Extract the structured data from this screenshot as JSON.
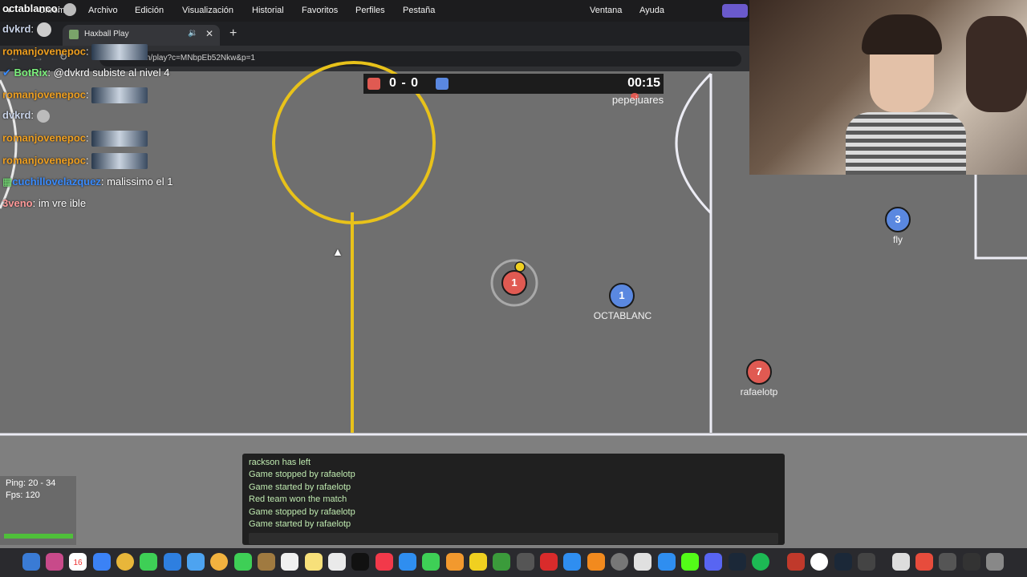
{
  "menubar": {
    "app_name": "Chrome",
    "items": [
      "Archivo",
      "Edición",
      "Visualización",
      "Historial",
      "Favoritos",
      "Perfiles",
      "Pestaña",
      "Ventana",
      "Ayuda"
    ]
  },
  "browser": {
    "tab_title": "Haxball Play",
    "url": "haxball.com/play?c=MNbpEb52Nkw&p=1"
  },
  "scoreboard": {
    "score": "0 - 0",
    "time": "00:15",
    "red_color": "#e05a52",
    "blue_color": "#5a88e0"
  },
  "players": [
    {
      "number": "1",
      "name": "",
      "team": "red"
    },
    {
      "number": "1",
      "name": "OCTABLANC",
      "team": "blue"
    },
    {
      "number": "3",
      "name": "fly",
      "team": "blue"
    },
    {
      "number": "7",
      "name": "rafaelotp",
      "team": "red"
    },
    {
      "number": "",
      "name": "pepejuares",
      "team": "red"
    }
  ],
  "stream_chat": [
    {
      "user": "octablanco",
      "message": "",
      "color": "#ffffff"
    },
    {
      "user": "dvkrd",
      "message": "",
      "color": "#c9d3e8"
    },
    {
      "user": "romanjovenepoc",
      "message": "",
      "color": "#f0a020"
    },
    {
      "user": "BotRix",
      "message": "@dvkrd subiste al nivel 4",
      "color": "#7cf07c"
    },
    {
      "user": "romanjovenepoc",
      "message": "",
      "color": "#f0a020"
    },
    {
      "user": "dvkrd",
      "message": "",
      "color": "#c9d3e8"
    },
    {
      "user": "romanjovenepoc",
      "message": "",
      "color": "#f0a020"
    },
    {
      "user": "romanjovenepoc",
      "message": "",
      "color": "#f0a020"
    },
    {
      "user": "cuchillovelazquez",
      "message": "malissimo el 1",
      "color": "#3a8cff"
    },
    {
      "user": "3veno",
      "message": "im vre ible",
      "color": "#ff9a9a"
    }
  ],
  "game_log": [
    "rackson has left",
    "Game stopped by rafaelotp",
    "Game started by rafaelotp",
    "Red team won the match",
    "Game stopped by rafaelotp",
    "Game started by rafaelotp"
  ],
  "stats": {
    "ping": "Ping: 20 - 34",
    "fps": "Fps: 120"
  },
  "dock": {
    "calendar_day": "16"
  }
}
